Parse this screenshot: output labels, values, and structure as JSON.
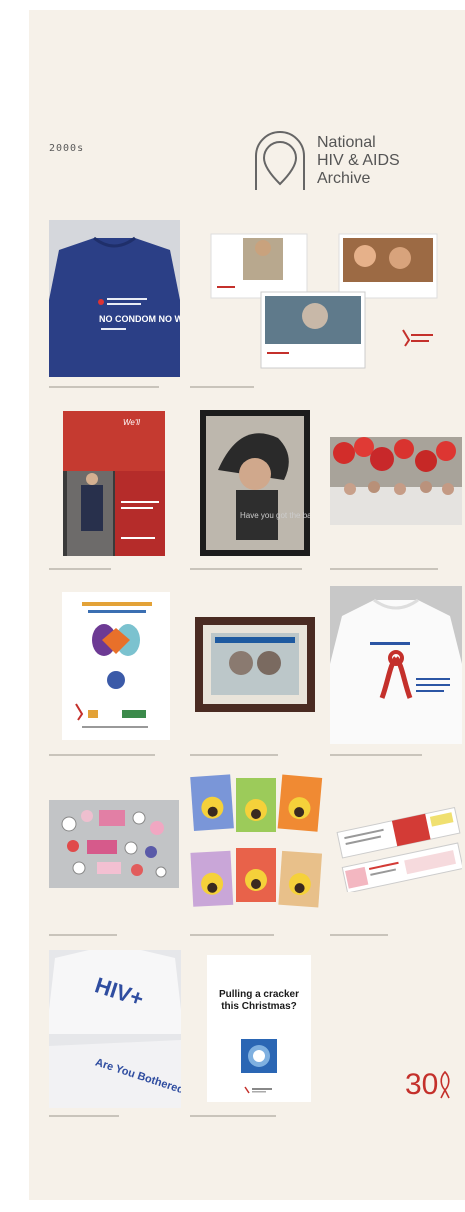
{
  "decade_label": "2000s",
  "logo": {
    "line1": "National",
    "line2": "HIV & AIDS",
    "line3": "Archive"
  },
  "items": [
    {
      "poster_text": "NO CONDOM NO WAY",
      "caption": ""
    },
    {
      "poster_text": "",
      "caption": ""
    },
    {
      "poster_text": "",
      "caption": ""
    },
    {
      "poster_text": "",
      "caption": ""
    },
    {
      "poster_text": "Have you got the balls?",
      "caption": ""
    },
    {
      "poster_text": "",
      "caption": ""
    },
    {
      "poster_text": "",
      "caption": ""
    },
    {
      "poster_text": "",
      "caption": ""
    },
    {
      "poster_text": "HIV+",
      "slogan": "Are You Bothered?",
      "caption": ""
    },
    {
      "poster_text": "Pulling a cracker this Christmas?",
      "caption": ""
    }
  ],
  "footer": {
    "line1": "",
    "line2": "",
    "big_number": "30"
  },
  "colors": {
    "background": "#f6f1e9",
    "accent_red": "#c4302b",
    "text_gray": "#555555"
  }
}
